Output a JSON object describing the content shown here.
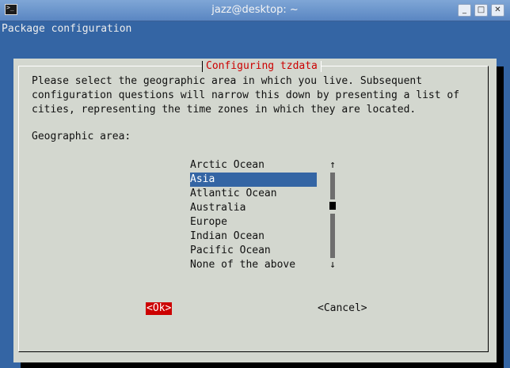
{
  "window": {
    "title": "jazz@desktop: ~",
    "icon": "terminal-icon",
    "buttons": {
      "minimize": "_",
      "maximize": "□",
      "close": "✕"
    }
  },
  "terminal": {
    "header": "Package configuration"
  },
  "dialog": {
    "title": "Configuring tzdata",
    "description_lines": [
      "Please select the geographic area in which you live. Subsequent",
      "configuration questions will narrow this down by presenting a list of",
      "cities, representing the time zones in which they are located."
    ],
    "prompt": "Geographic area:",
    "options": [
      "Arctic Ocean",
      "Asia",
      "Atlantic Ocean",
      "Australia",
      "Europe",
      "Indian Ocean",
      "Pacific Ocean",
      "None of the above"
    ],
    "selected_option": "Asia",
    "scroll": {
      "up_arrow": "↑",
      "down_arrow": "↓"
    },
    "ok_label": "<Ok>",
    "cancel_label": "<Cancel>",
    "colors": {
      "title": "#cc0000",
      "selection": "#3465a4",
      "dialog_bg": "#d3d7cf",
      "terminal_bg": "#3465a4"
    }
  }
}
